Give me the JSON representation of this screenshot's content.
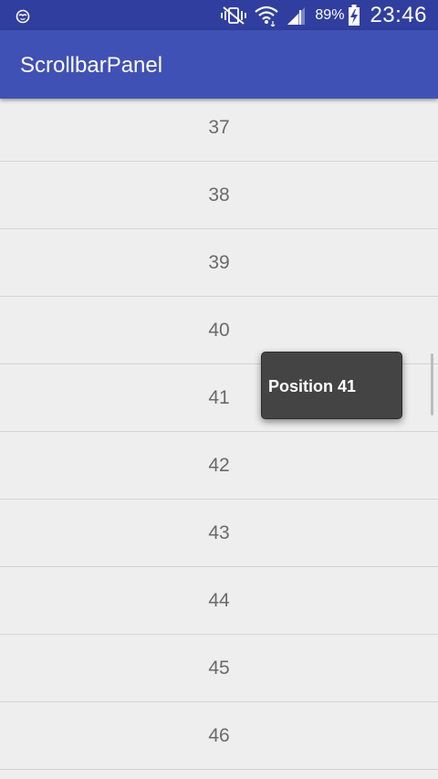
{
  "status_bar": {
    "battery_percent": "89%",
    "time": "23:46",
    "icons": [
      "notification-app-icon",
      "vibrate-silent-icon",
      "wifi-icon",
      "signal-icon",
      "battery-charging-icon"
    ]
  },
  "app_bar": {
    "title": "ScrollbarPanel"
  },
  "list": {
    "items": [
      "37",
      "38",
      "39",
      "40",
      "41",
      "42",
      "43",
      "44",
      "45",
      "46"
    ]
  },
  "popup": {
    "text": "Position 41"
  },
  "colors": {
    "status_bar": "#303f9f",
    "app_bar": "#3f51b5",
    "background": "#eeeeee",
    "popup": "#444444"
  }
}
